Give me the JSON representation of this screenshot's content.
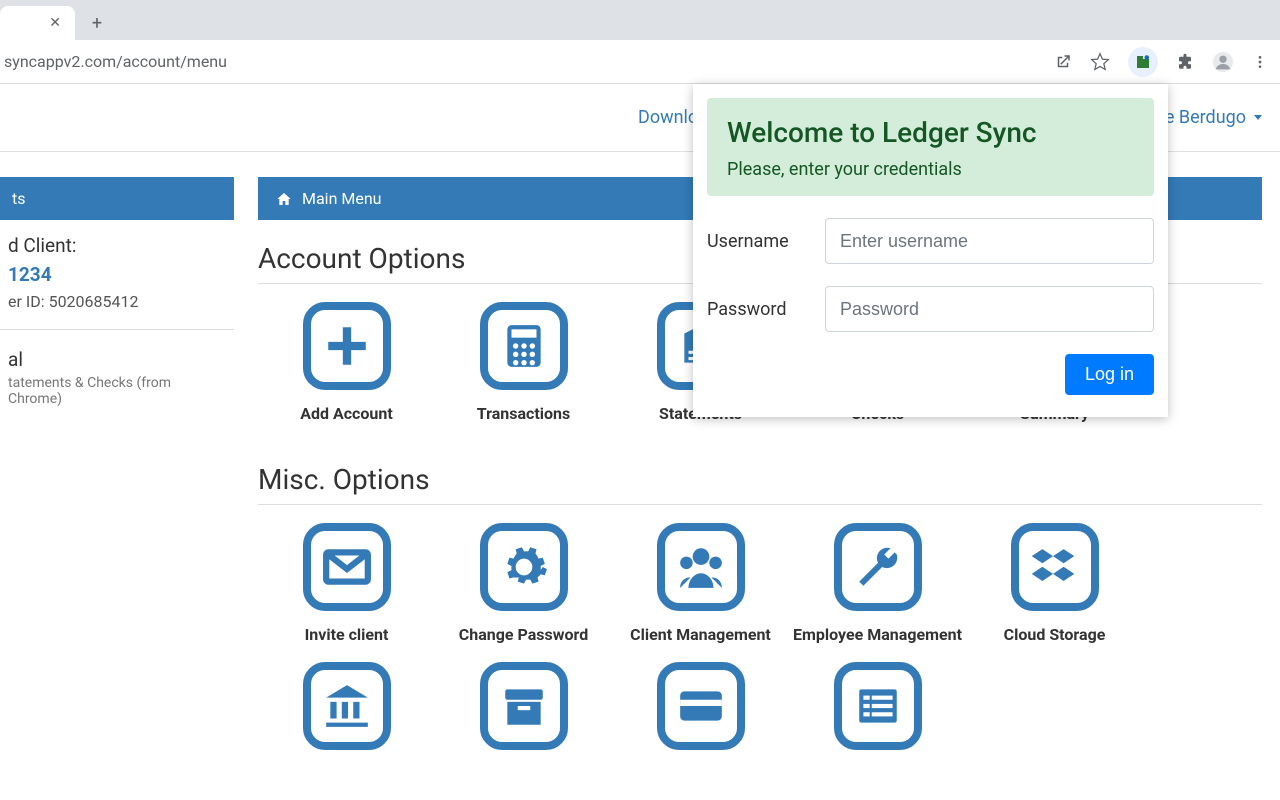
{
  "browser": {
    "url_fragment": "syncappv2.com/account/menu"
  },
  "header": {
    "download_text": "Downloa",
    "user_text": "ce Berdugo"
  },
  "sidebar": {
    "tab_label": "ts",
    "selected_client_label": "d Client:",
    "client_code": "1234",
    "client_id_label": "er ID: 5020685412",
    "section2_title": "al",
    "section2_sub": "tatements & Checks (from Chrome)"
  },
  "main": {
    "breadcrumb": "Main Menu",
    "section1_title": "Account Options",
    "section2_title": "Misc. Options",
    "account_items": [
      {
        "label": "Add Account",
        "icon": "plus"
      },
      {
        "label": "Transactions",
        "icon": "calculator"
      },
      {
        "label": "Statements",
        "icon": "book"
      },
      {
        "label": "Checks",
        "icon": "checks"
      },
      {
        "label": "Summary",
        "icon": "summary"
      }
    ],
    "misc_items": [
      {
        "label": "Invite client",
        "icon": "envelope"
      },
      {
        "label": "Change Password",
        "icon": "gear"
      },
      {
        "label": "Client Management",
        "icon": "users"
      },
      {
        "label": "Employee Management",
        "icon": "wrench"
      },
      {
        "label": "Cloud Storage",
        "icon": "dropbox"
      }
    ],
    "row3_icons": [
      "bank",
      "archive",
      "card",
      "list"
    ]
  },
  "popup": {
    "title": "Welcome to Ledger Sync",
    "subtitle": "Please, enter your credentials",
    "username_label": "Username",
    "username_placeholder": "Enter username",
    "password_label": "Password",
    "password_placeholder": "Password",
    "login_button": "Log in"
  }
}
